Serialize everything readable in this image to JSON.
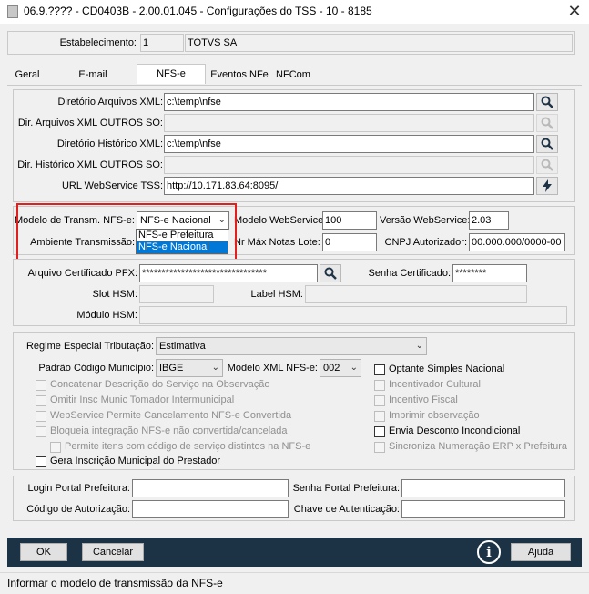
{
  "window": {
    "title": "06.9.???? - CD0403B - 2.00.01.045 - Configurações do TSS - 10 - 8185",
    "close_glyph": "✕"
  },
  "establishment": {
    "label": "Estabelecimento:",
    "code": "1",
    "name": "TOTVS SA"
  },
  "tabs": [
    {
      "label": "Geral"
    },
    {
      "label": "E-mail"
    },
    {
      "label": "NFS-e",
      "active": true
    },
    {
      "label": "Eventos NFe"
    },
    {
      "label": "NFCom"
    }
  ],
  "directories": {
    "xml_dir_label": "Diretório Arquivos XML:",
    "xml_dir_value": "c:\\temp\\nfse",
    "xml_other_label": "Dir. Arquivos XML OUTROS SO:",
    "xml_other_value": "",
    "hist_dir_label": "Diretório Histórico XML:",
    "hist_dir_value": "c:\\temp\\nfse",
    "hist_other_label": "Dir. Histórico XML OUTROS SO:",
    "hist_other_value": "",
    "url_label": "URL WebService TSS:",
    "url_value": "http://10.171.83.64:8095/"
  },
  "transmission": {
    "model_label": "Modelo de Transm. NFS-e:",
    "model_value": "NFS-e Nacional",
    "model_options": [
      "NFS-e Prefeitura",
      "NFS-e Nacional"
    ],
    "env_label": "Ambiente Transmissão:",
    "ws_model_label": "Modelo WebService:",
    "ws_model_value": "100",
    "ws_version_label": "Versão WebService:",
    "ws_version_value": "2.03",
    "max_notes_label": "Nr Máx Notas Lote:",
    "max_notes_value": "0",
    "cnpj_label": "CNPJ Autorizador:",
    "cnpj_value": "00.000.000/0000-00"
  },
  "certificate": {
    "pfx_label": "Arquivo Certificado PFX:",
    "pfx_value": "********************************",
    "password_label": "Senha Certificado:",
    "password_value": "********",
    "slot_label": "Slot HSM:",
    "slot_value": "",
    "label_hsm_label": "Label HSM:",
    "label_hsm_value": "",
    "module_label": "Módulo HSM:",
    "module_value": ""
  },
  "tax": {
    "regime_label": "Regime Especial Tributação:",
    "regime_value": "Estimativa",
    "city_code_label": "Padrão Código Município:",
    "city_code_value": "IBGE",
    "xml_model_label": "Modelo XML NFS-e:",
    "xml_model_value": "002",
    "left_checks": [
      {
        "label": "Concatenar Descrição do Serviço na Observação",
        "enabled": false
      },
      {
        "label": "Omitir Insc Munic Tomador Intermunicipal",
        "enabled": false
      },
      {
        "label": "WebService Permite Cancelamento NFS-e Convertida",
        "enabled": false
      },
      {
        "label": "Bloqueia integração NFS-e não convertida/cancelada",
        "enabled": false
      },
      {
        "label": "Permite itens com código de serviço distintos na NFS-e",
        "enabled": false
      },
      {
        "label": "Gera Inscrição Municipal do Prestador",
        "enabled": true
      }
    ],
    "right_checks": [
      {
        "label": "Optante Simples Nacional",
        "enabled": true
      },
      {
        "label": "Incentivador Cultural",
        "enabled": false
      },
      {
        "label": "Incentivo Fiscal",
        "enabled": false
      },
      {
        "label": "Imprimir observação",
        "enabled": false
      },
      {
        "label": "Envia Desconto Incondicional",
        "enabled": true
      },
      {
        "label": "Sincroniza Numeração ERP x Prefeitura",
        "enabled": false
      }
    ]
  },
  "portal": {
    "login_label": "Login Portal Prefeitura:",
    "login_value": "",
    "senha_label": "Senha Portal Prefeitura:",
    "senha_value": "",
    "auth_code_label": "Código de Autorização:",
    "auth_code_value": "",
    "auth_key_label": "Chave de Autenticação:",
    "auth_key_value": ""
  },
  "buttons": {
    "ok": "OK",
    "cancel": "Cancelar",
    "help": "Ajuda",
    "info_glyph": "i"
  },
  "status": {
    "text": "Informar o modelo de transmissão da NFS-e"
  },
  "colors": {
    "highlight_box": "#e21f1f",
    "bottom_bar": "#1b3345",
    "selected_option": "#0078d7"
  },
  "icons": [
    "search-icon",
    "lightning-icon",
    "info-icon",
    "close-icon",
    "chevron-down-icon",
    "app-icon"
  ]
}
